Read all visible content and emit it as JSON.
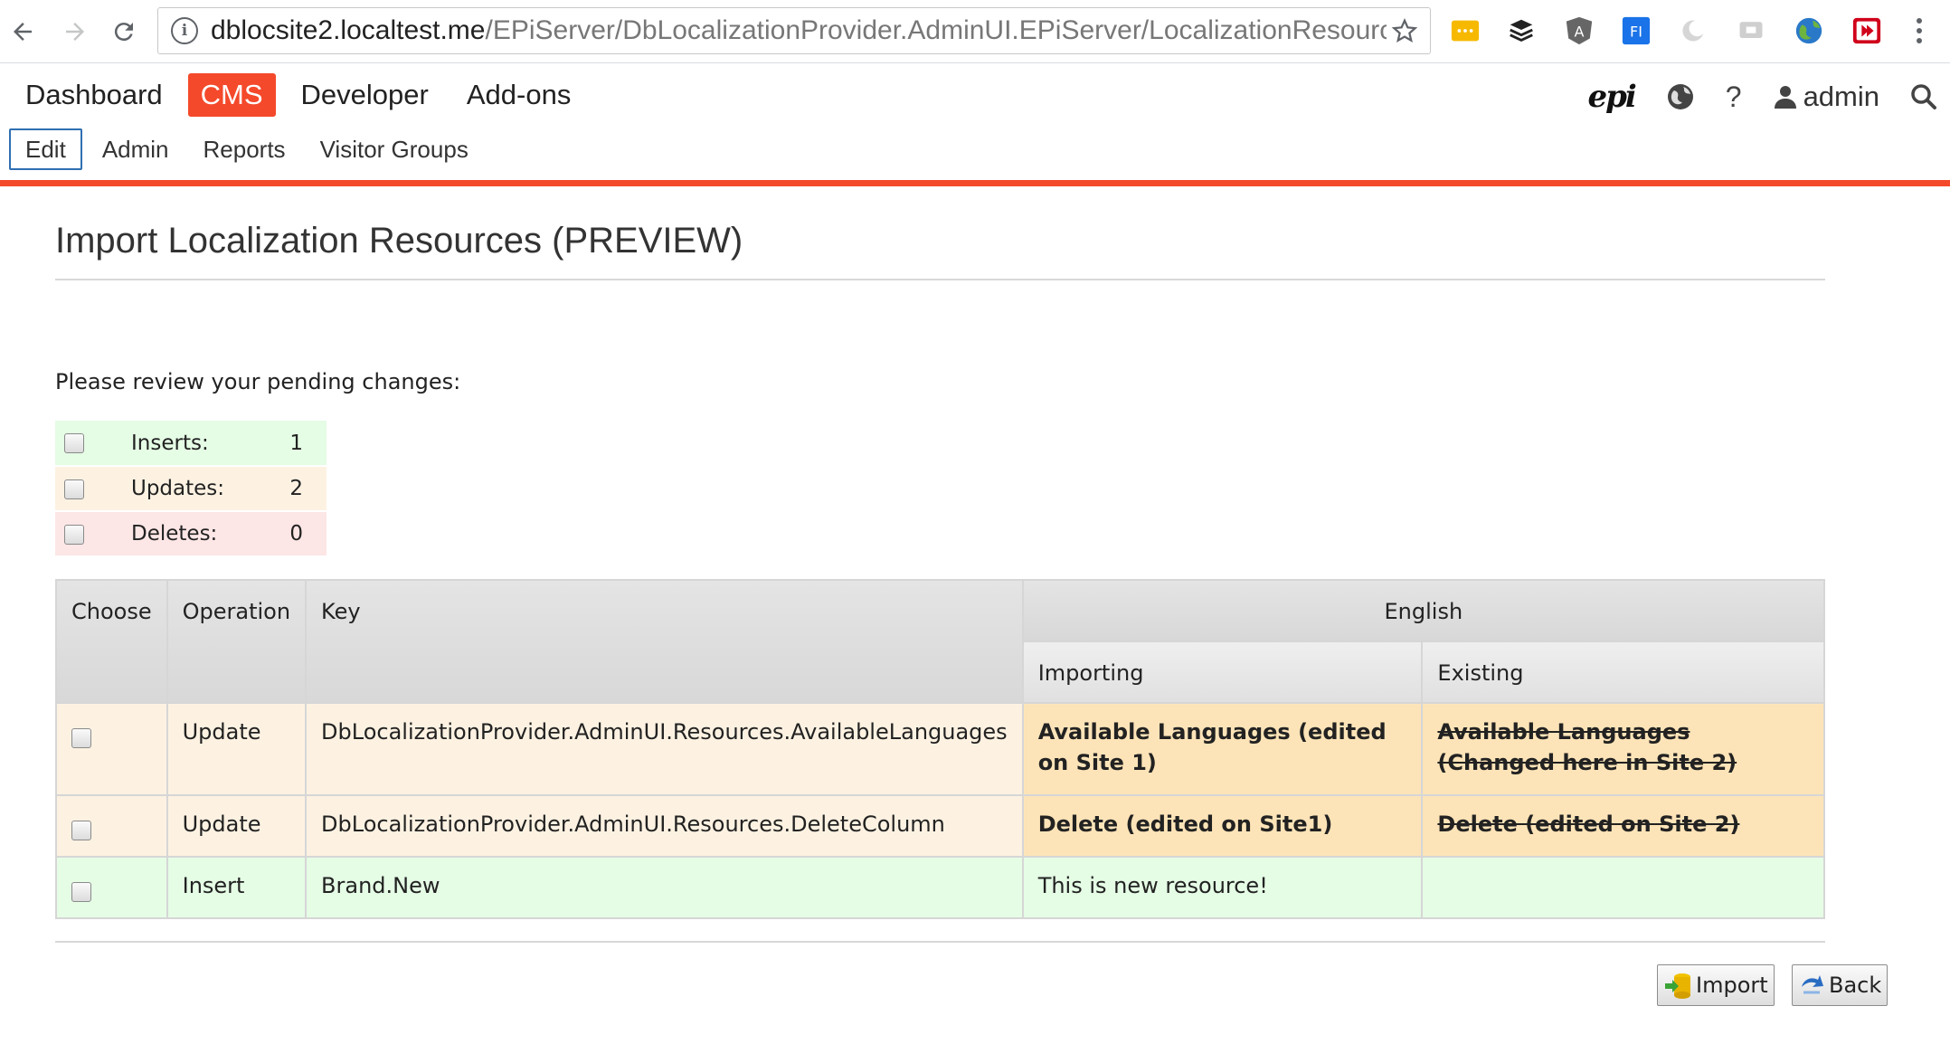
{
  "browser": {
    "url_host": "dblocsite2.localtest.me",
    "url_path": "/EPiServer/DbLocalizationProvider.AdminUI.EPiServer/LocalizationResources/Impor",
    "extensions": [
      "...",
      "buffer-icon",
      "angular-icon",
      "fi-icon",
      "moon-icon",
      "cast-icon",
      "globe-icon",
      "video-icon"
    ]
  },
  "nav": {
    "main": [
      "Dashboard",
      "CMS",
      "Developer",
      "Add-ons"
    ],
    "active_main": "CMS",
    "sub": [
      "Edit",
      "Admin",
      "Reports",
      "Visitor Groups"
    ],
    "active_sub": "Edit",
    "user": "admin",
    "help": "?",
    "brand": "epi"
  },
  "page": {
    "title": "Import Localization Resources (PREVIEW)",
    "intro": "Please review your pending changes:"
  },
  "summary": [
    {
      "label": "Inserts:",
      "value": "1"
    },
    {
      "label": "Updates:",
      "value": "2"
    },
    {
      "label": "Deletes:",
      "value": "0"
    }
  ],
  "table": {
    "headers": {
      "choose": "Choose",
      "operation": "Operation",
      "key": "Key",
      "language": "English",
      "importing": "Importing",
      "existing": "Existing"
    },
    "rows": [
      {
        "operation": "Update",
        "key": "DbLocalizationProvider.AdminUI.Resources.AvailableLanguages",
        "importing": "Available Languages (edited on Site 1)",
        "existing": "Available Languages (Changed here in Site 2)"
      },
      {
        "operation": "Update",
        "key": "DbLocalizationProvider.AdminUI.Resources.DeleteColumn",
        "importing": "Delete (edited on Site1)",
        "existing": "Delete (edited on Site 2)"
      },
      {
        "operation": "Insert",
        "key": "Brand.New",
        "importing": "This is new resource!",
        "existing": ""
      }
    ]
  },
  "buttons": {
    "import": "Import",
    "back": "Back"
  },
  "colors": {
    "accent": "#f4492a",
    "insert_bg": "#e5fce5",
    "update_bg": "#fdf2e2",
    "update_cell_bg": "#fde4b8",
    "delete_bg": "#fde6e6"
  }
}
